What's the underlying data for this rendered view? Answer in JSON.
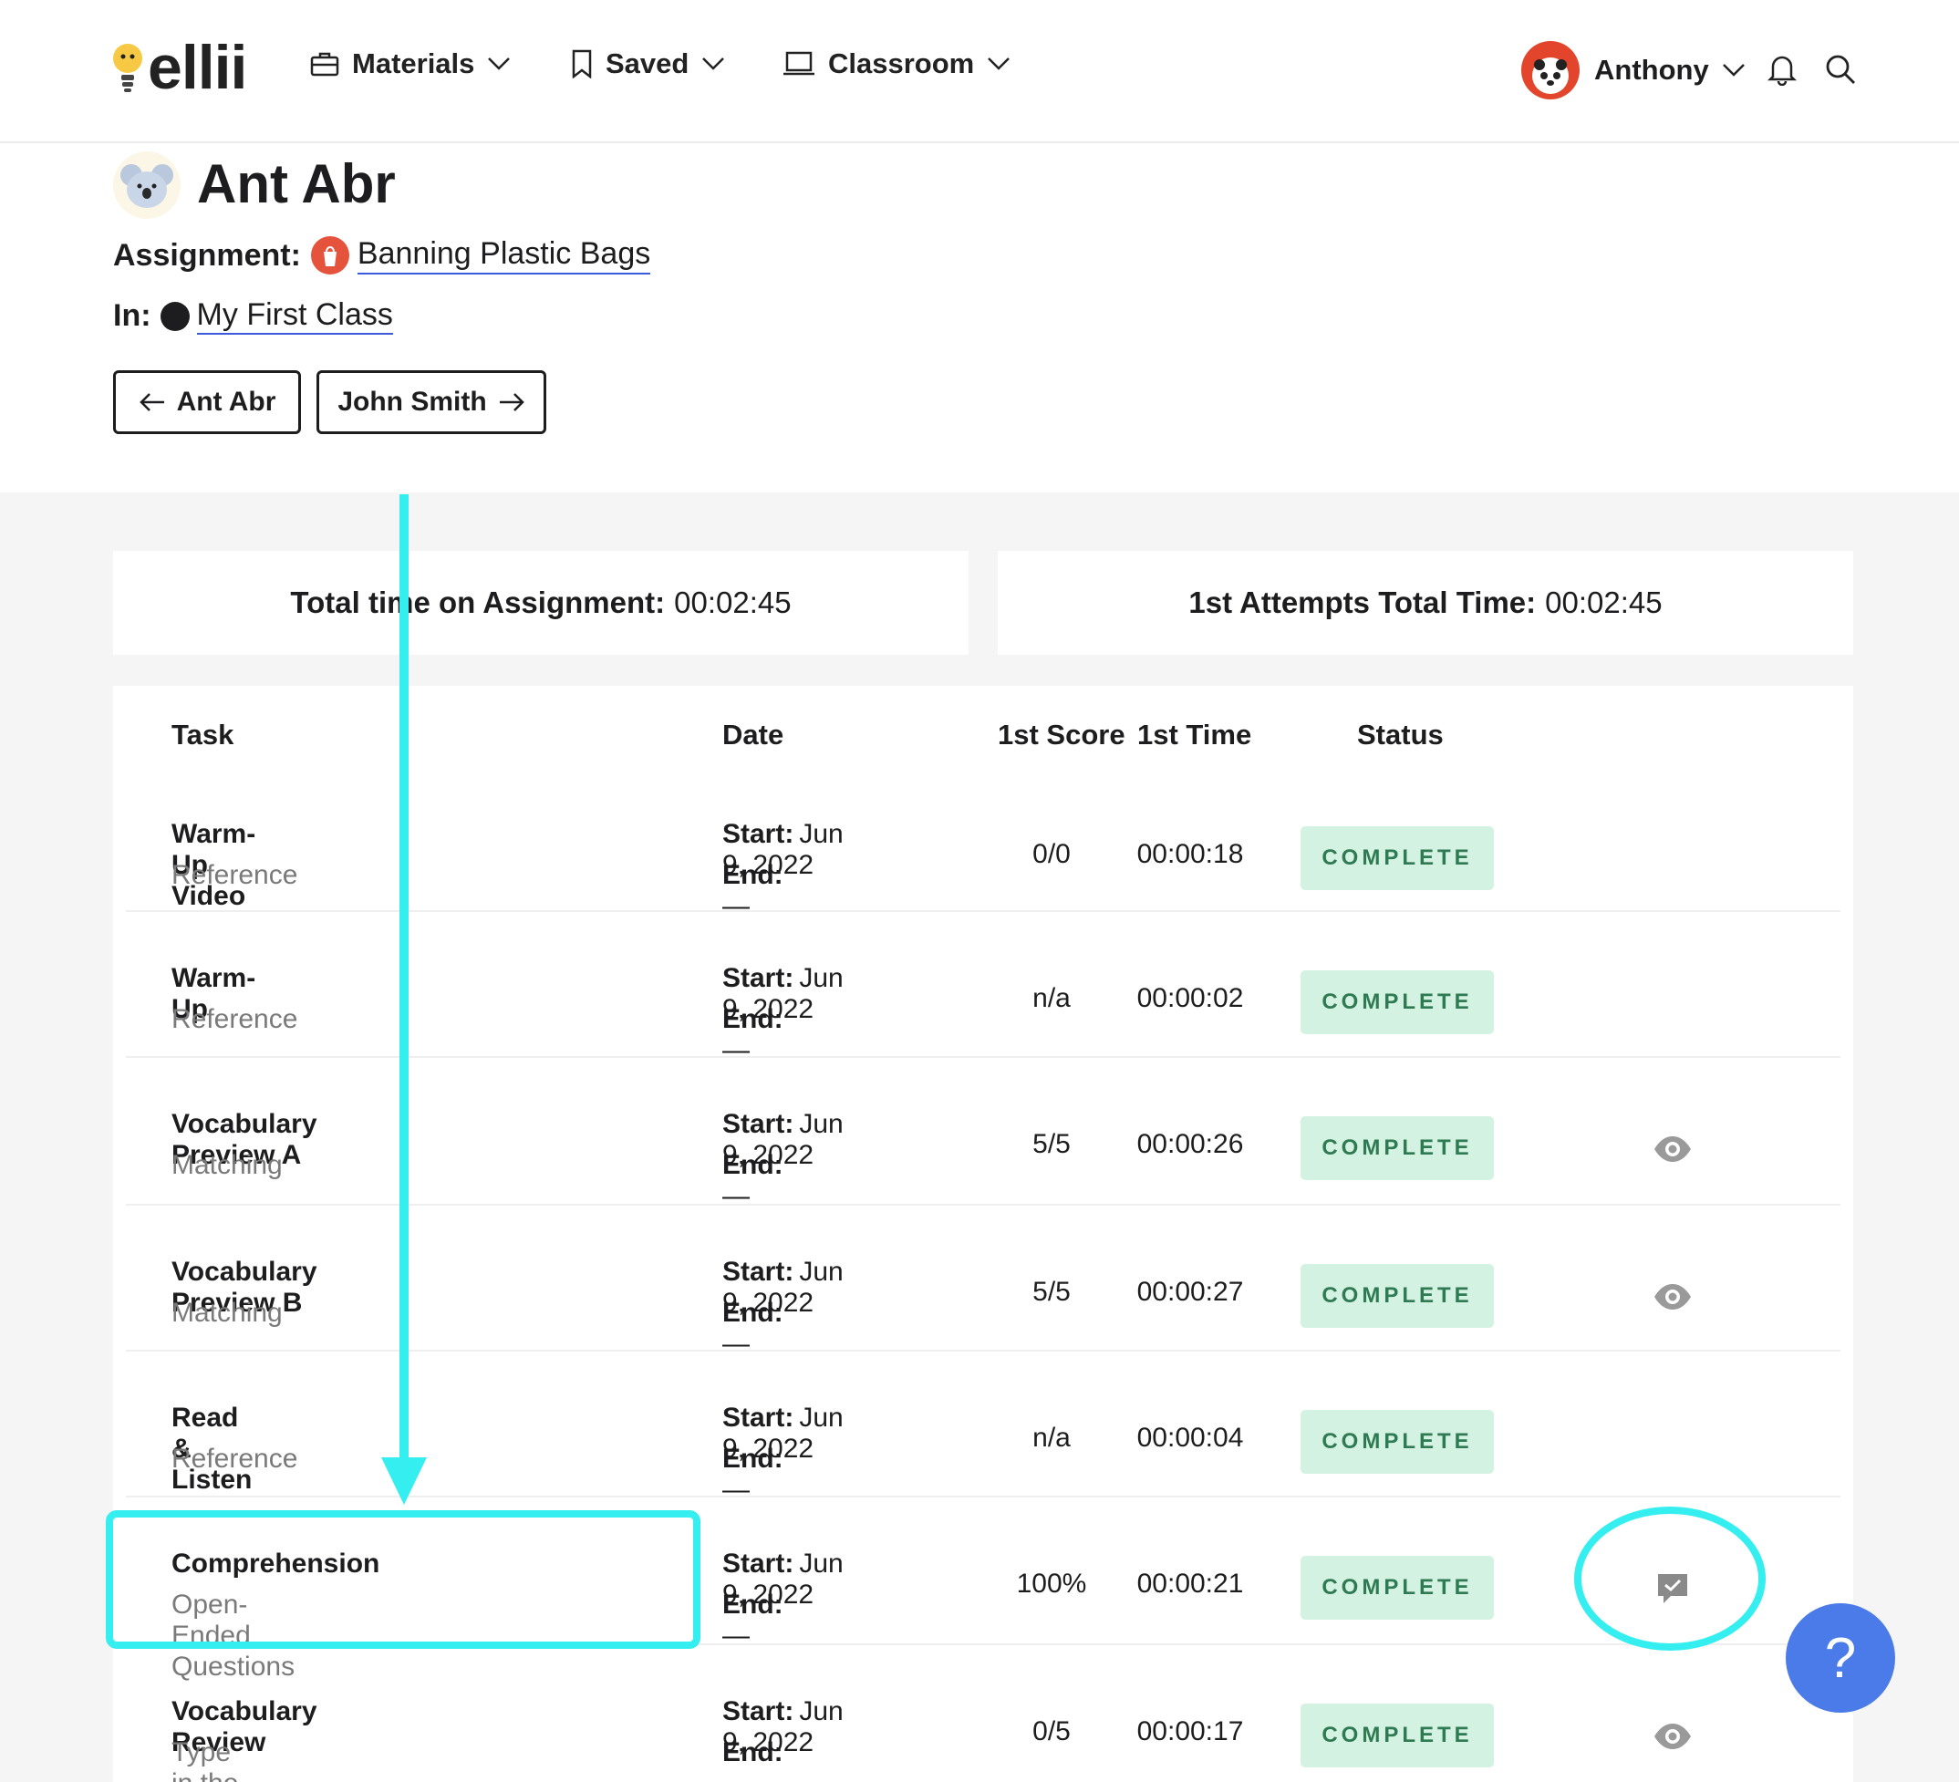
{
  "header": {
    "logo": "ellii",
    "nav": [
      {
        "label": "Materials",
        "icon": "briefcase-icon"
      },
      {
        "label": "Saved",
        "icon": "bookmark-icon"
      },
      {
        "label": "Classroom",
        "icon": "laptop-icon"
      }
    ],
    "user": {
      "name": "Anthony"
    }
  },
  "student": {
    "name": "Ant Abr",
    "assignment_label": "Assignment:",
    "assignment": "Banning Plastic Bags",
    "class_label": "In:",
    "class_name": "My First Class",
    "prev_button": "Ant Abr",
    "next_button": "John Smith"
  },
  "summary": {
    "total_time_label": "Total time on Assignment:",
    "total_time": "00:02:45",
    "first_attempts_label": "1st Attempts Total Time:",
    "first_attempts_time": "00:02:45"
  },
  "table": {
    "columns": {
      "task": "Task",
      "date": "Date",
      "score": "1st Score",
      "time": "1st Time",
      "status": "Status"
    },
    "start_label": "Start:",
    "end_label": "End:",
    "rows": [
      {
        "task": "Warm-Up Video",
        "type": "Reference",
        "start": "Jun 9, 2022",
        "end": "—",
        "score": "0/0",
        "time": "00:00:18",
        "status": "COMPLETE",
        "action": ""
      },
      {
        "task": "Warm-Up",
        "type": "Reference",
        "start": "Jun 9, 2022",
        "end": "—",
        "score": "n/a",
        "time": "00:00:02",
        "status": "COMPLETE",
        "action": ""
      },
      {
        "task": "Vocabulary Preview A",
        "type": "Matching",
        "start": "Jun 9, 2022",
        "end": "—",
        "score": "5/5",
        "time": "00:00:26",
        "status": "COMPLETE",
        "action": "eye-icon"
      },
      {
        "task": "Vocabulary Preview B",
        "type": "Matching",
        "start": "Jun 9, 2022",
        "end": "—",
        "score": "5/5",
        "time": "00:00:27",
        "status": "COMPLETE",
        "action": "eye-icon"
      },
      {
        "task": "Read & Listen",
        "type": "Reference",
        "start": "Jun 9, 2022",
        "end": "—",
        "score": "n/a",
        "time": "00:00:04",
        "status": "COMPLETE",
        "action": ""
      },
      {
        "task": "Comprehension",
        "type": "Open-Ended Questions",
        "start": "Jun 9, 2022",
        "end": "—",
        "score": "100%",
        "time": "00:00:21",
        "status": "COMPLETE",
        "action": "feedback-icon"
      },
      {
        "task": "Vocabulary Review",
        "type": "Type in the Blanks",
        "start": "Jun 9, 2022",
        "end": "—",
        "score": "0/5",
        "time": "00:00:17",
        "status": "COMPLETE",
        "action": "eye-icon"
      }
    ]
  },
  "help": {
    "label": "?"
  },
  "colors": {
    "annotation": "#34eeef",
    "status_bg": "#d4f2e1",
    "status_text": "#2e7a52",
    "help": "#4a7be8",
    "link_underline": "#3b5bdb"
  }
}
